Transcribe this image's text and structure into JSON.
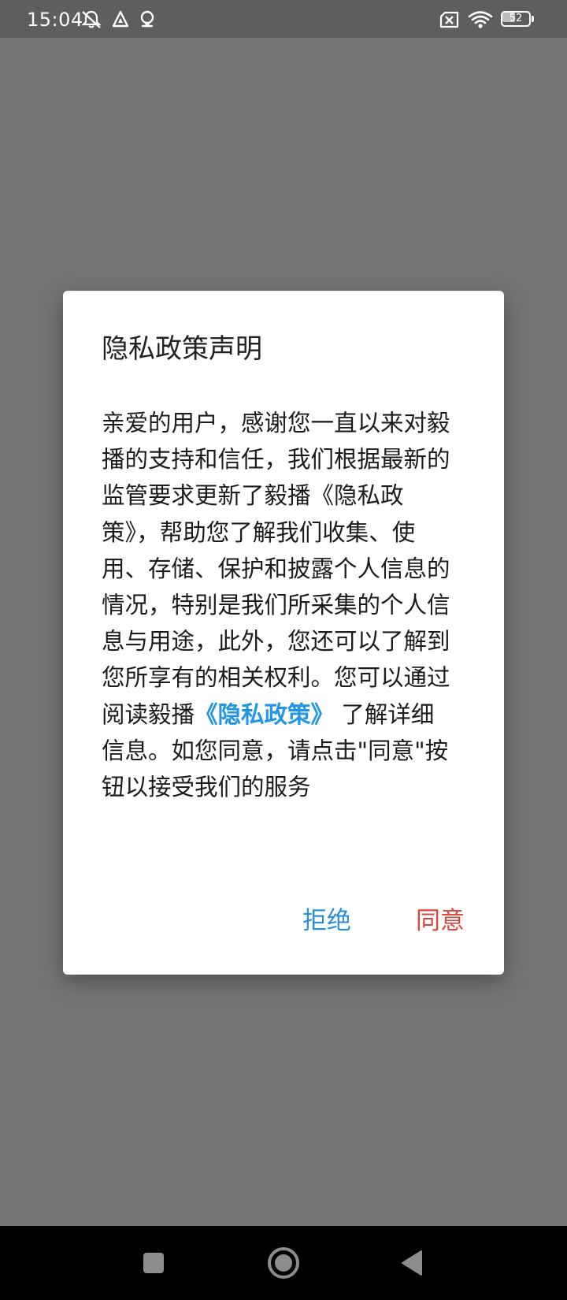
{
  "status_bar": {
    "time": "15:04",
    "icons": [
      "notifications-off-icon",
      "navigation-triangle-icon",
      "location-pin-icon",
      "sim-off-icon",
      "wifi-icon"
    ],
    "battery_level": "52",
    "battery_fraction": 0.52
  },
  "dialog": {
    "title": "隐私政策声明",
    "body_before_link": "亲爱的用户，感谢您一直以来对毅播的支持和信任，我们根据最新的监管要求更新了毅播《隐私政策》，帮助您了解我们收集、使用、存储、保护和披露个人信息的情况，特别是我们所采集的个人信息与用途，此外，您还可以了解到您所享有的相关权利。您可以通过阅读毅播",
    "policy_link": "《隐私政策》",
    "body_after_link": " 了解详细信息。如您同意，请点击\"同意\"按钮以接受我们的服务",
    "reject_label": "拒绝",
    "agree_label": "同意"
  },
  "colors": {
    "link": "#2196e6",
    "reject": "#2b8fd8",
    "agree": "#e0443a",
    "overlay": "#757575"
  },
  "nav_bar": {
    "buttons": [
      "recents-square-icon",
      "home-circle-icon",
      "back-triangle-icon"
    ]
  }
}
